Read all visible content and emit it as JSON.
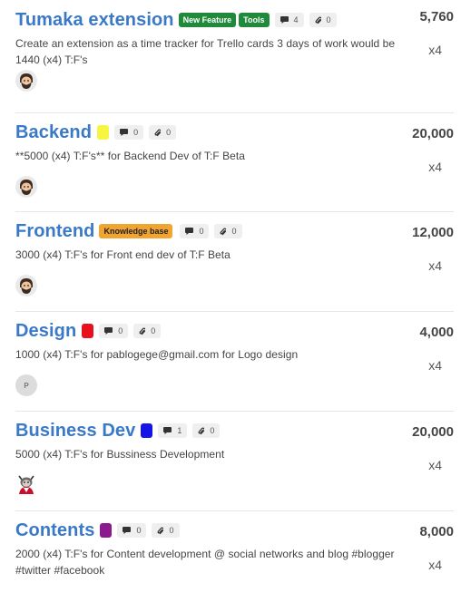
{
  "cards": [
    {
      "title": "Tumaka extension",
      "labels": [
        {
          "text": "New Feature",
          "color": "#1f8a3a"
        },
        {
          "text": "Tools",
          "color": "#1f8a3a"
        }
      ],
      "swatch_color": null,
      "comments": "4",
      "attachments": "0",
      "description": "Create an extension as a time tracker for Trello cards 3 days of work would be 1440 (x4) T:F's",
      "points": "5,760",
      "multiplier": "x4",
      "avatar": {
        "type": "bearded-face"
      }
    },
    {
      "title": "Backend",
      "labels": [],
      "swatch_color": "#f5f542",
      "comments": "0",
      "attachments": "0",
      "description": "**5000 (x4) T:F's** for Backend Dev of T:F Beta",
      "points": "20,000",
      "multiplier": "x4",
      "avatar": {
        "type": "bearded-face"
      }
    },
    {
      "title": "Frontend",
      "labels": [
        {
          "text": "Knowledge base",
          "color": "#f2a431",
          "text_color": "#222222"
        }
      ],
      "swatch_color": null,
      "comments": "0",
      "attachments": "0",
      "description": "3000 (x4) T:F's for Front end dev of T:F Beta",
      "points": "12,000",
      "multiplier": "x4",
      "avatar": {
        "type": "bearded-face"
      }
    },
    {
      "title": "Design",
      "labels": [],
      "swatch_color": "#e8101a",
      "comments": "0",
      "attachments": "0",
      "description": "1000 (x4) T:F's for pablogege@gmail.com for Logo design",
      "points": "4,000",
      "multiplier": "x4",
      "avatar": {
        "type": "initial",
        "text": "P"
      }
    },
    {
      "title": "Business Dev",
      "labels": [],
      "swatch_color": "#1414e6",
      "comments": "1",
      "attachments": "0",
      "description": "5000 (x4) T:F's for Bussiness Development",
      "points": "20,000",
      "multiplier": "x4",
      "avatar": {
        "type": "character"
      }
    },
    {
      "title": "Contents",
      "labels": [],
      "swatch_color": "#8a1a8e",
      "comments": "0",
      "attachments": "0",
      "description": "2000 (x4) T:F's for Content development @ social networks and blog #blogger #twitter #facebook",
      "points": "8,000",
      "multiplier": "x4",
      "avatar": null
    }
  ]
}
